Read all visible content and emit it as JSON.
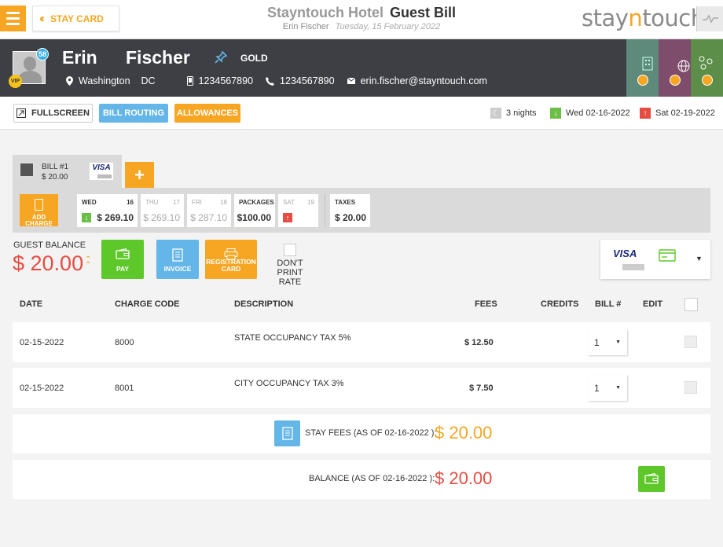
{
  "topbar": {
    "stay_card_label": "STAY CARD",
    "hotel_name": "Stayntouch Hotel",
    "page_title": "Guest Bill",
    "guest_name": "Erin Fischer",
    "date": "Tuesday, 15 February 2022",
    "brand_pre": "stay",
    "brand_o": "n",
    "brand_post": "touch"
  },
  "guest": {
    "first_name": "Erin",
    "last_name": "Fischer",
    "notification_count": "58",
    "vip_label": "VIP",
    "membership": "GOLD",
    "city": "Washington",
    "state": "DC",
    "mobile": "1234567890",
    "phone": "1234567890",
    "email": "erin.fischer@stayntouch.com"
  },
  "actions": {
    "fullscreen": "FULLSCREEN",
    "bill_routing": "BILL ROUTING",
    "allowances": "ALLOWANCES",
    "nights": "3 nights",
    "arrival": "Wed 02-16-2022",
    "departure": "Sat 02-19-2022"
  },
  "bill": {
    "number": "BILL #1",
    "amount": "$ 20.00",
    "card_brand": "VISA",
    "add_bill": "+",
    "add_charge_line1": "ADD",
    "add_charge_line2": "CHARGE"
  },
  "days": [
    {
      "name": "WED",
      "num": "16",
      "amount": "$ 269.10"
    },
    {
      "name": "THU",
      "num": "17",
      "amount": "$ 269.10"
    },
    {
      "name": "FRI",
      "num": "18",
      "amount": "$ 287.10"
    },
    {
      "name": "PACKAGES",
      "num": "",
      "amount": "$100.00"
    },
    {
      "name": "SAT",
      "num": "19",
      "amount": ""
    },
    {
      "name": "TAXES",
      "num": "",
      "amount": "$ 20.00"
    }
  ],
  "balance": {
    "label": "GUEST BALANCE",
    "amount": "$ 20.00",
    "pay": "PAY",
    "invoice": "INVOICE",
    "reg_line1": "REGISTRATION",
    "reg_line2": "CARD",
    "dont_print": "DON'T PRINT RATE",
    "card_brand": "VISA"
  },
  "table": {
    "headers": {
      "date": "DATE",
      "charge_code": "CHARGE CODE",
      "description": "DESCRIPTION",
      "fees": "FEES",
      "credits": "CREDITS",
      "bill": "BILL #",
      "edit": "EDIT"
    },
    "rows": [
      {
        "date": "02-15-2022",
        "code": "8000",
        "description": "STATE OCCUPANCY TAX 5%",
        "fees": "$ 12.50",
        "bill": "1"
      },
      {
        "date": "02-15-2022",
        "code": "8001",
        "description": "CITY OCCUPANCY TAX 3%",
        "fees": "$ 7.50",
        "bill": "1"
      }
    ]
  },
  "summary": {
    "stay_fees_label": "STAY FEES (AS OF 02-16-2022 ):",
    "stay_fees_amount": "$ 20.00",
    "balance_label": "BALANCE (AS OF 02-16-2022 ):",
    "balance_amount": "$ 20.00"
  },
  "colors": {
    "accent_orange": "#f6a623",
    "balance_red": "#e54d42",
    "routing_blue": "#64b5e8",
    "pay_green": "#5ec72a",
    "header_dark": "#3d3f44"
  }
}
